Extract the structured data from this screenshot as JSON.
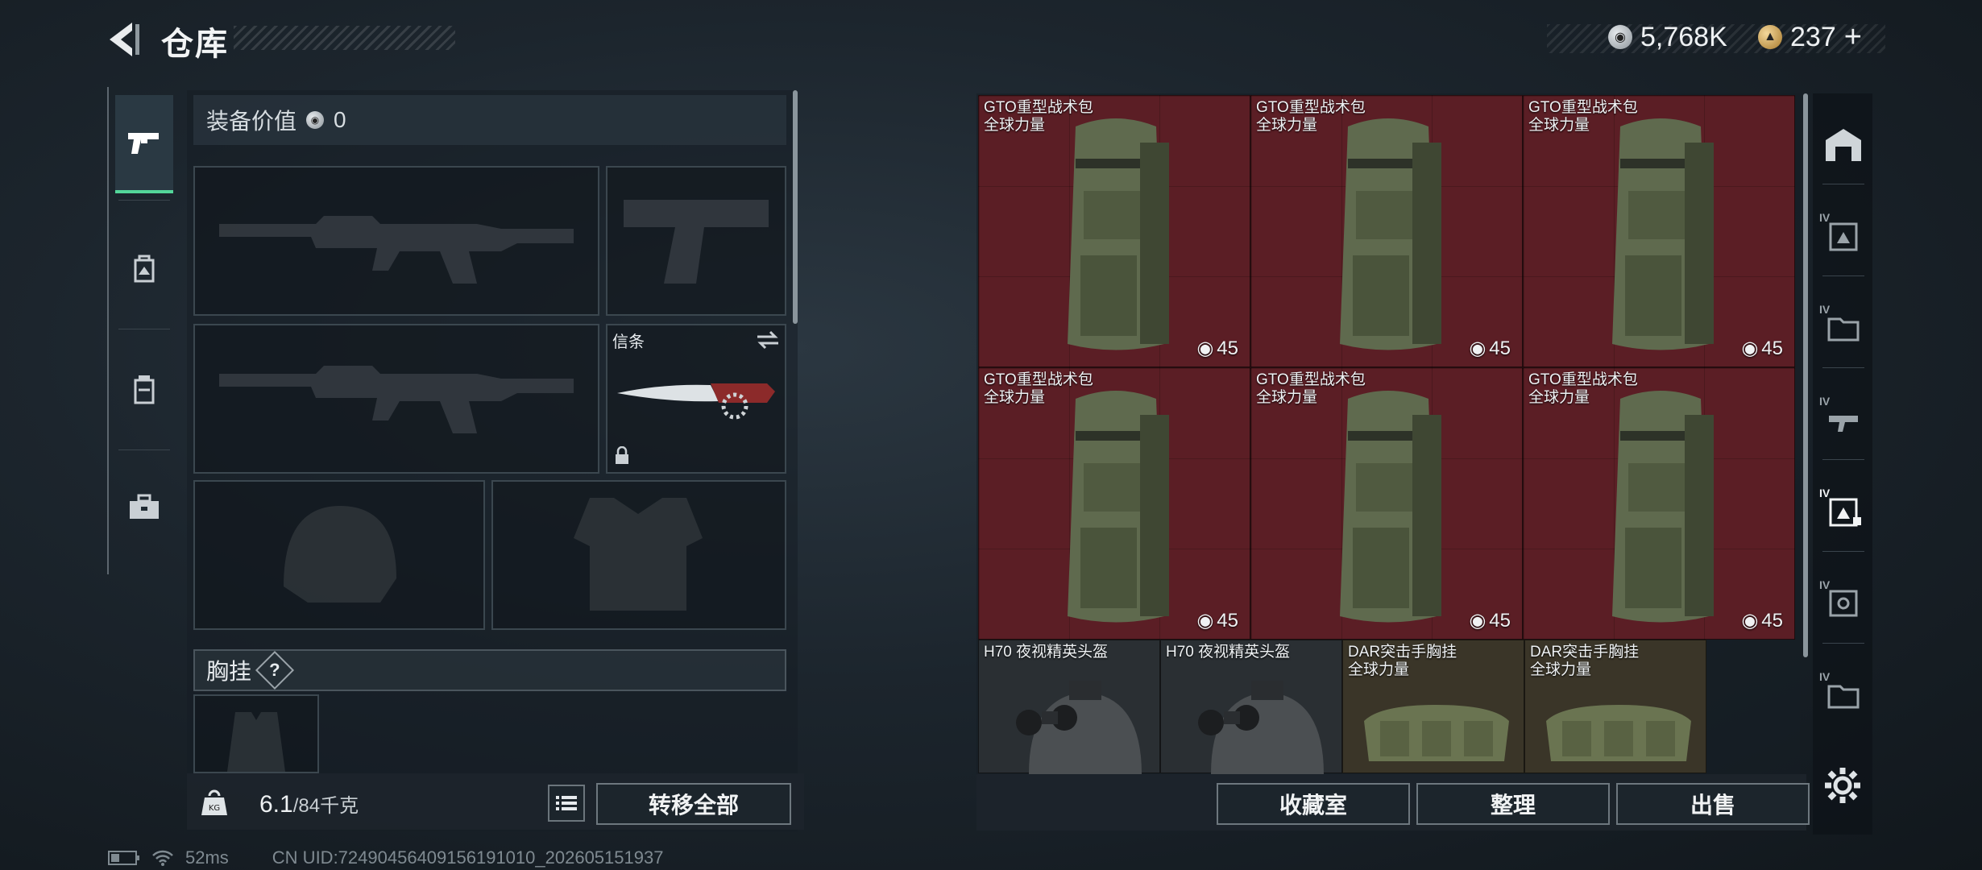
{
  "header": {
    "title": "仓库",
    "currency_silver": "5,768K",
    "currency_gold": "237",
    "add_symbol": "+"
  },
  "tabs": [
    {
      "icon": "pistol-icon",
      "active": true
    },
    {
      "icon": "backpack-icon",
      "active": false
    },
    {
      "icon": "chest-rig-icon",
      "active": false
    },
    {
      "icon": "toolbox-icon",
      "active": false
    }
  ],
  "loadout": {
    "value_label": "装备价值",
    "value": "0",
    "melee_label": "信条",
    "rig_label": "胸挂",
    "rig_help": "?"
  },
  "footer_left": {
    "weight_value": "6.1",
    "weight_max": "/84千克",
    "transfer_all": "转移全部"
  },
  "stash": {
    "items": [
      {
        "name": "GTO重型战术包",
        "sub": "全球力量",
        "capacity": "45"
      },
      {
        "name": "GTO重型战术包",
        "sub": "全球力量",
        "capacity": "45"
      },
      {
        "name": "GTO重型战术包",
        "sub": "全球力量",
        "capacity": "45"
      },
      {
        "name": "GTO重型战术包",
        "sub": "全球力量",
        "capacity": "45"
      },
      {
        "name": "GTO重型战术包",
        "sub": "全球力量",
        "capacity": "45"
      },
      {
        "name": "GTO重型战术包",
        "sub": "全球力量",
        "capacity": "45"
      },
      {
        "name": "H70 夜视精英头盔",
        "sub": ""
      },
      {
        "name": "H70 夜视精英头盔",
        "sub": ""
      },
      {
        "name": "DAR突击手胸挂",
        "sub": "全球力量"
      },
      {
        "name": "DAR突击手胸挂",
        "sub": "全球力量"
      }
    ]
  },
  "footer_right": {
    "collection": "收藏室",
    "sort": "整理",
    "sell": "出售"
  },
  "rail_tier_label": "IV",
  "status": {
    "ping": "52ms",
    "uid": "CN UID:7249045640915619101­0_202605151937"
  },
  "colors": {
    "accent": "#53d69a",
    "stash_red": "#5b1e25"
  }
}
